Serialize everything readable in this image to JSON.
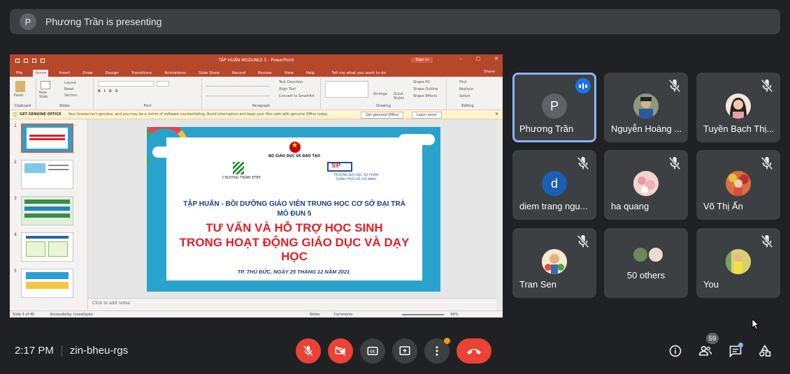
{
  "presenting": {
    "avatar_letter": "P",
    "text": "Phương Trần is presenting"
  },
  "powerpoint": {
    "doc_title": "TẬP HUẤN MODUNLE 5  -  PowerPoint",
    "signin": "Sign in",
    "tabs": [
      "File",
      "Home",
      "Insert",
      "Draw",
      "Design",
      "Transitions",
      "Animations",
      "Slide Show",
      "Record",
      "Review",
      "View",
      "Help"
    ],
    "tell_me": "Tell me what you want to do",
    "share": "Share",
    "groups": [
      "Clipboard",
      "Slides",
      "Font",
      "Paragraph",
      "Drawing",
      "Editing"
    ],
    "ribbon_items": {
      "paste": "Paste",
      "new_slide": "New Slide",
      "layout": "Layout",
      "reset": "Reset",
      "section": "Section",
      "text_direction": "Text Direction",
      "align_text": "Align Text",
      "smartart": "Convert to SmartArt",
      "arrange": "Arrange",
      "quick_styles": "Quick Styles",
      "shape_fill": "Shape Fill",
      "shape_outline": "Shape Outline",
      "shape_effects": "Shape Effects",
      "find": "Find",
      "replace": "Replace",
      "select": "Select"
    },
    "warning": {
      "title": "GET GENUINE OFFICE",
      "message": "Your license isn't genuine, and you may be a victim of software counterfeiting. Avoid interruption and keep your files safe with genuine Office today.",
      "btn1": "Get genuine Office",
      "btn2": "Learn more"
    },
    "thumb_numbers": [
      "1",
      "2",
      "3",
      "4",
      "5"
    ],
    "notes_placeholder": "Click to add notes",
    "status": {
      "slide": "Slide 1 of 40",
      "accessibility": "Accessibility: Investigate",
      "notes": "Notes",
      "comments": "Comments",
      "zoom": "84%"
    },
    "slide": {
      "ministry": "BỘ GIÁO DỤC VÀ ĐÀO TẠO",
      "etep": "CHƯƠNG TRÌNH ETEP",
      "university_line1": "TRƯỜNG ĐẠI HỌC SƯ PHẠM",
      "university_line2": "THÀNH PHỐ HỒ CHÍ MINH",
      "heading1": "TẬP HUẤN - BỒI DƯỠNG GIÁO VIÊN TRUNG HỌC CƠ SỞ ĐẠI TRÀ",
      "heading2": "MÔ ĐUN 5",
      "title1": "TƯ  VẤN VÀ HỖ TRỢ HỌC SINH",
      "title2": "TRONG HOẠT ĐỘNG GIÁO DỤC VÀ DẠY HỌC",
      "date": "TP. THỦ ĐỨC, NGÀY 25 THÁNG 12 NĂM 2021"
    }
  },
  "participants": [
    {
      "name": "Phương Trần",
      "letter": "P",
      "color": "#5f6368",
      "speaking": true
    },
    {
      "name": "Nguyễn Hoàng ...",
      "letter": "",
      "color": "#7a8a6a",
      "muted": true
    },
    {
      "name": "Tuyền Bạch Thị...",
      "letter": "",
      "color": "#d9c7b8",
      "muted": true
    },
    {
      "name": "diem trang ngu...",
      "letter": "d",
      "color": "#1a5fb4",
      "muted": true
    },
    {
      "name": "ha quang",
      "letter": "",
      "color": "#e8b4b8",
      "muted": true
    },
    {
      "name": "Võ Thị Ấn",
      "letter": "",
      "color": "#c85a3a",
      "muted": true
    },
    {
      "name": "Tran Sen",
      "letter": "",
      "color": "#f0d9a0",
      "muted": true
    },
    {
      "name": "50 others",
      "letter": "",
      "color": "#3c4043"
    },
    {
      "name": "You",
      "letter": "",
      "color": "#c9c06a",
      "muted": true
    }
  ],
  "bottom": {
    "time": "2:17 PM",
    "meeting_code": "zin-bheu-rgs",
    "people_count": "59"
  },
  "colors": {
    "background": "#202124",
    "tile": "#3c4043",
    "danger": "#ea4335",
    "accent": "#8ab4f8",
    "powerpoint": "#b7472a"
  }
}
